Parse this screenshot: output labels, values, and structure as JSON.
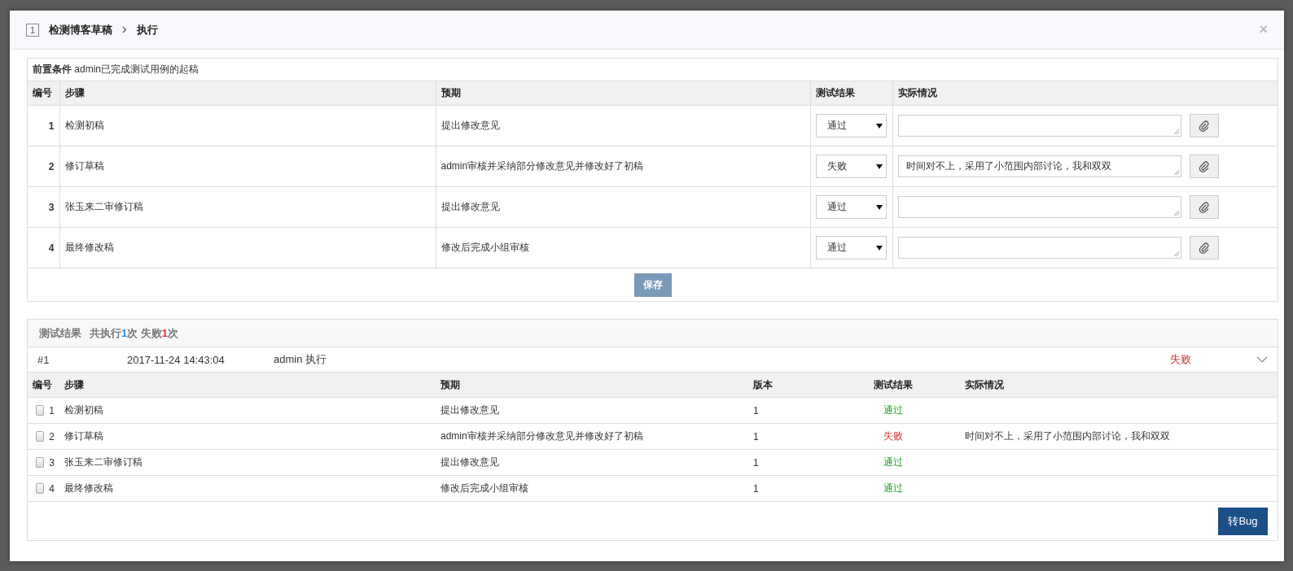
{
  "dialog": {
    "case_id": "1",
    "title": "检测博客草稿",
    "action": "执行",
    "close": "×"
  },
  "precondition": {
    "label": "前置条件",
    "text": "admin已完成测试用例的起稿"
  },
  "steps_table": {
    "columns": [
      "编号",
      "步骤",
      "预期",
      "测试结果",
      "实际情况"
    ],
    "rows": [
      {
        "id": "1",
        "step": "检测初稿",
        "expected": "提出修改意见",
        "result": "通过"
      },
      {
        "id": "2",
        "step": "修订草稿",
        "expected": "admin审核并采纳部分修改意见并修改好了初稿",
        "result": "失败",
        "actual": "时间对不上，采用了小范围内部讨论，我和双双"
      },
      {
        "id": "3",
        "step": "张玉来二审修订稿",
        "expected": "提出修改意见",
        "result": "通过"
      },
      {
        "id": "4",
        "step": "最终修改稿",
        "expected": "修改后完成小组审核",
        "result": "通过"
      }
    ]
  },
  "save_button": "保存",
  "results": {
    "title": "测试结果",
    "summary": [
      {
        "kind": "text",
        "text": "共执行"
      },
      {
        "kind": "total",
        "text": "1"
      },
      {
        "kind": "text",
        "text": "次 失败"
      },
      {
        "kind": "failed",
        "text": "1"
      },
      {
        "kind": "text",
        "text": "次"
      }
    ],
    "run": {
      "number": "#1",
      "time": "2017-11-24 14:43:04",
      "executor": "admin 执行",
      "result": "失败",
      "kind": "fail",
      "expanded": true
    },
    "columns": [
      "编号",
      "步骤",
      "预期",
      "版本",
      "测试结果",
      "实际情况"
    ],
    "rows": [
      {
        "checked": false,
        "id": "1",
        "step": "检测初稿",
        "expected": "提出修改意见",
        "version": "1",
        "result": "通过",
        "kind": "pass"
      },
      {
        "checked": false,
        "id": "2",
        "step": "修订草稿",
        "expected": "admin审核并采纳部分修改意见并修改好了初稿",
        "version": "1",
        "result": "失败",
        "kind": "fail",
        "actual": "时间对不上，采用了小范围内部讨论，我和双双"
      },
      {
        "checked": false,
        "id": "3",
        "step": "张玉来二审修订稿",
        "expected": "提出修改意见",
        "version": "1",
        "result": "通过",
        "kind": "pass"
      },
      {
        "checked": false,
        "id": "4",
        "step": "最终修改稿",
        "expected": "修改后完成小组审核",
        "version": "1",
        "result": "通过",
        "kind": "pass"
      }
    ],
    "bug_button": "转Bug"
  }
}
